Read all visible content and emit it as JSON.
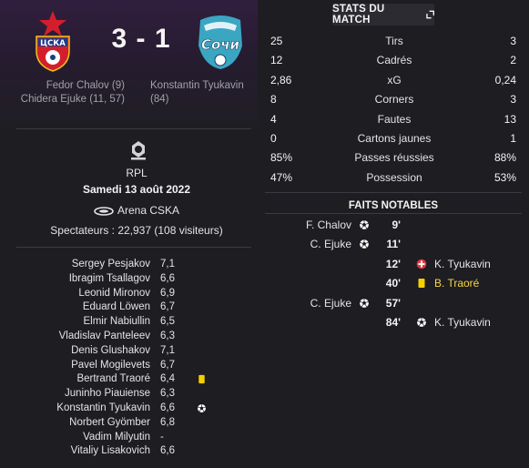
{
  "match": {
    "home_team": {
      "crest": "cska-crest",
      "crest_text": "ЦСКА"
    },
    "away_team": {
      "crest": "sochi-crest",
      "crest_text": "Сочи"
    },
    "score": "3 - 1",
    "home_scorers": [
      "Fedor Chalov (9)",
      "Chidera Ejuke (11, 57)"
    ],
    "away_scorers": [
      "Konstantin Tyukavin",
      "(84)"
    ],
    "competition": "RPL",
    "date": "Samedi 13 août 2022",
    "venue": "Arena CSKA",
    "spectators": "Spectateurs : 22,937 (108 visiteurs)"
  },
  "ratings": [
    {
      "name": "Sergey Pesjakov",
      "rating": "7,1",
      "event": ""
    },
    {
      "name": "Ibragim Tsallagov",
      "rating": "6,6",
      "event": ""
    },
    {
      "name": "Leonid Mironov",
      "rating": "6,9",
      "event": ""
    },
    {
      "name": "Eduard Löwen",
      "rating": "6,7",
      "event": ""
    },
    {
      "name": "Elmir Nabiullin",
      "rating": "6,5",
      "event": ""
    },
    {
      "name": "Vladislav Panteleev",
      "rating": "6,3",
      "event": ""
    },
    {
      "name": "Denis Glushakov",
      "rating": "7,1",
      "event": ""
    },
    {
      "name": "Pavel Mogilevets",
      "rating": "6,7",
      "event": ""
    },
    {
      "name": "Bertrand Traoré",
      "rating": "6,4",
      "event": "yellow-card-icon"
    },
    {
      "name": "Juninho Piauiense",
      "rating": "6,3",
      "event": ""
    },
    {
      "name": "Konstantin Tyukavin",
      "rating": "6,6",
      "event": "goal-ball-icon"
    },
    {
      "name": "Norbert Gyömber",
      "rating": "6,8",
      "event": ""
    },
    {
      "name": "Vadim Milyutin",
      "rating": "-",
      "event": ""
    },
    {
      "name": "Vitaliy Lisakovich",
      "rating": "6,6",
      "event": ""
    }
  ],
  "stats": {
    "title": "STATS DU MATCH",
    "rows": [
      {
        "home": "25",
        "label": "Tirs",
        "away": "3"
      },
      {
        "home": "12",
        "label": "Cadrés",
        "away": "2"
      },
      {
        "home": "2,86",
        "label": "xG",
        "away": "0,24"
      },
      {
        "home": "8",
        "label": "Corners",
        "away": "3"
      },
      {
        "home": "4",
        "label": "Fautes",
        "away": "13"
      },
      {
        "home": "0",
        "label": "Cartons jaunes",
        "away": "1"
      },
      {
        "home": "85%",
        "label": "Passes réussies",
        "away": "88%"
      },
      {
        "home": "47%",
        "label": "Possession",
        "away": "53%"
      }
    ]
  },
  "events": {
    "title": "FAITS NOTABLES",
    "rows": [
      {
        "side": "home",
        "player": "F. Chalov",
        "minute": "9'",
        "icon": "goal-ball-icon"
      },
      {
        "side": "home",
        "player": "C. Ejuke",
        "minute": "11'",
        "icon": "goal-ball-icon"
      },
      {
        "side": "away",
        "player": "K. Tyukavin",
        "minute": "12'",
        "icon": "injury-icon"
      },
      {
        "side": "away",
        "player": "B. Traoré",
        "minute": "40'",
        "icon": "yellow-card-icon"
      },
      {
        "side": "home",
        "player": "C. Ejuke",
        "minute": "57'",
        "icon": "goal-ball-icon"
      },
      {
        "side": "away",
        "player": "K. Tyukavin",
        "minute": "84'",
        "icon": "goal-ball-icon"
      }
    ]
  },
  "colors": {
    "background": "#1d1d22",
    "header_purple": "#311e3e",
    "cska_red": "#d21f2b",
    "cska_blue": "#1c3a8c",
    "sochi_teal": "#3aa6c2",
    "yellow_card": "#f5d000",
    "injury_red": "#e0383e"
  }
}
